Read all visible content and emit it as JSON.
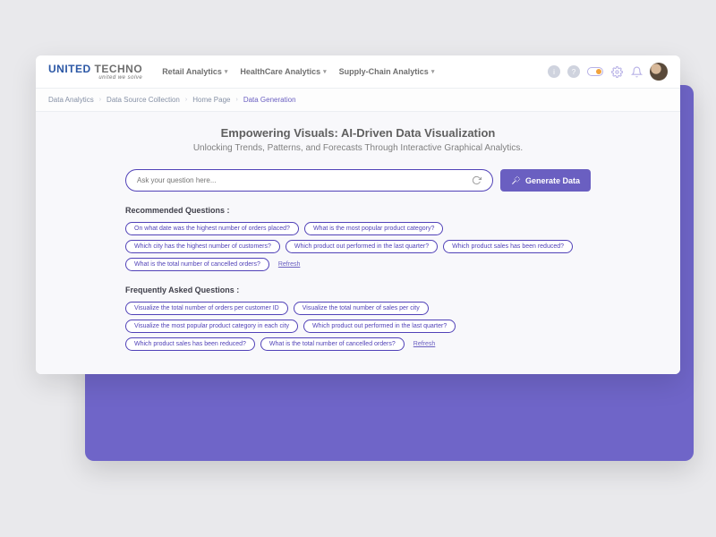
{
  "logo": {
    "part1": "UNITED",
    "part2": "TECHNO",
    "tagline": "united we solve"
  },
  "nav": {
    "items": [
      {
        "label": "Retail Analytics"
      },
      {
        "label": "HealthCare Analytics"
      },
      {
        "label": "Supply-Chain Analytics"
      }
    ]
  },
  "breadcrumb": {
    "items": [
      "Data Analytics",
      "Data Source Collection",
      "Home Page"
    ],
    "current": "Data Generation"
  },
  "hero": {
    "title": "Empowering Visuals: AI-Driven Data Visualization",
    "subtitle": "Unlocking Trends, Patterns, and Forecasts Through Interactive Graphical Analytics."
  },
  "search": {
    "placeholder": "Ask your question here..."
  },
  "generate_label": "Generate Data",
  "recommended": {
    "title": "Recommended Questions :",
    "chips": [
      "On what date was the highest number of orders placed?",
      "What is the most popular product category?",
      "Which city has the highest number of customers?",
      "Which product out performed in the last quarter?",
      "Which product sales has been reduced?",
      "What is the total number of cancelled orders?"
    ],
    "refresh": "Refresh"
  },
  "faq": {
    "title": "Frequently Asked Questions :",
    "chips": [
      "Visualize the total number  of orders per customer ID",
      "Visualize the total number of sales per city",
      "Visualize the most popular product category in each city",
      "Which product out performed in the last quarter?",
      "Which product sales has been reduced?",
      "What is the total number of cancelled orders?"
    ],
    "refresh": "Refresh"
  }
}
